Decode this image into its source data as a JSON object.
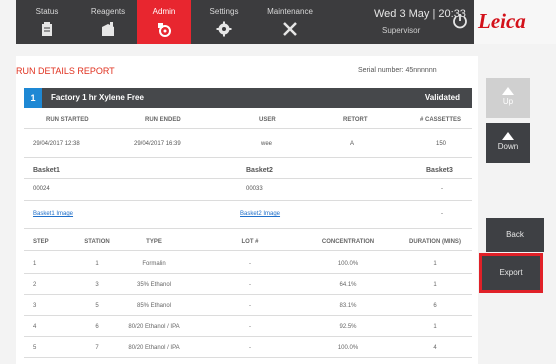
{
  "nav": {
    "tabs": [
      {
        "label": "Status",
        "icon": "status-icon"
      },
      {
        "label": "Reagents",
        "icon": "reagents-icon"
      },
      {
        "label": "Admin",
        "icon": "admin-icon",
        "active": true
      },
      {
        "label": "Settings",
        "icon": "gear-icon"
      },
      {
        "label": "Maintenance",
        "icon": "tools-icon"
      }
    ],
    "datetime": "Wed 3 May | 20:33",
    "user": "Supervisor",
    "logo": "Leica"
  },
  "report": {
    "title": "RUN DETAILS REPORT",
    "serial": "Serial number: 45nnnnnn",
    "protocol": {
      "number": "1",
      "name": "Factory 1 hr Xylene Free",
      "status": "Validated"
    },
    "run_headers": [
      "RUN STARTED",
      "RUN ENDED",
      "USER",
      "RETORT",
      "# CASSETTES"
    ],
    "run_values": [
      "29/04/2017 12:38",
      "29/04/2017 16:39",
      "wee",
      "A",
      "150"
    ],
    "baskets": {
      "headers": [
        "Basket1",
        "Basket2",
        "Basket3"
      ],
      "ids": [
        "00024",
        "00033",
        "-"
      ],
      "links": [
        "Basket1 Image",
        "Basket2 Image",
        "-"
      ]
    },
    "step_headers": [
      "STEP",
      "STATION",
      "TYPE",
      "LOT #",
      "CONCENTRATION",
      "DURATION (MINS)"
    ],
    "steps": [
      [
        "1",
        "1",
        "Formalin",
        "-",
        "100.0%",
        "1"
      ],
      [
        "2",
        "3",
        "35% Ethanol",
        "-",
        "64.1%",
        "1"
      ],
      [
        "3",
        "5",
        "85% Ethanol",
        "-",
        "83.1%",
        "6"
      ],
      [
        "4",
        "6",
        "80/20 Ethanol / IPA",
        "-",
        "92.5%",
        "1"
      ],
      [
        "5",
        "7",
        "80/20 Ethanol / IPA",
        "-",
        "100.0%",
        "4"
      ]
    ]
  },
  "side_buttons": {
    "up": "Up",
    "down": "Down",
    "back": "Back",
    "export": "Export"
  },
  "colors": {
    "accent": "#e8262f",
    "protocol_number": "#1e88d4",
    "dark_bar": "#3c3c3e",
    "highlight": "#e02128"
  }
}
